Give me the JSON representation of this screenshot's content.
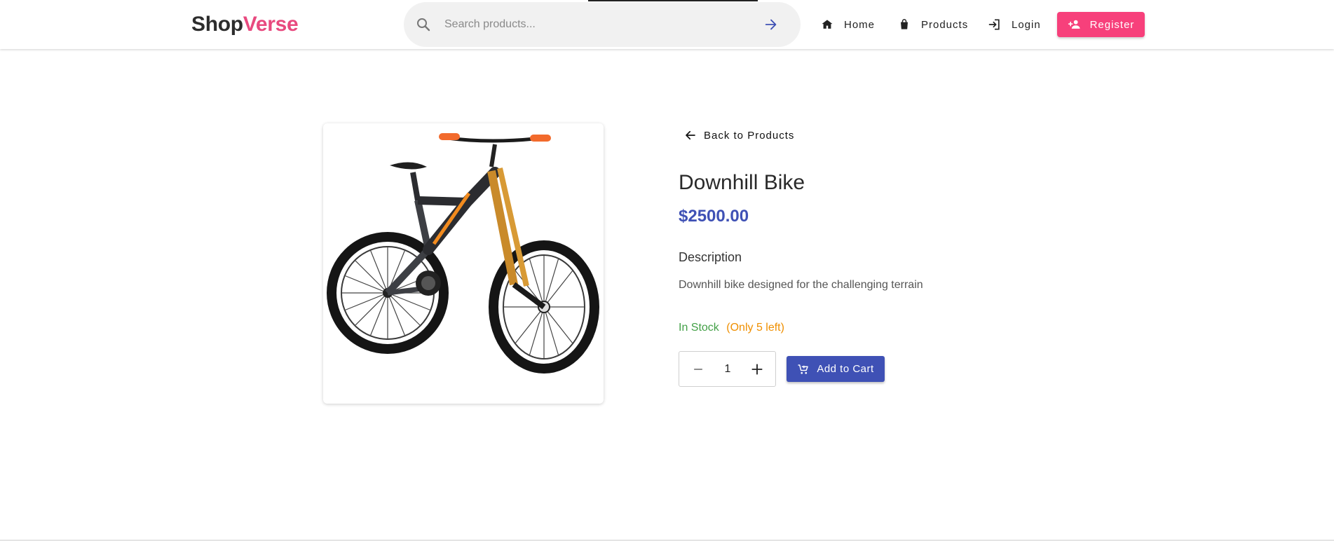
{
  "header": {
    "logo_part1": "Shop",
    "logo_part2": "Verse",
    "search": {
      "placeholder": "Search products...",
      "value": "",
      "icon": "search-icon",
      "submit_icon": "arrow-right-icon"
    },
    "nav": {
      "home": {
        "label": "Home",
        "icon": "home-icon"
      },
      "products": {
        "label": "Products",
        "icon": "shopping-bag-icon"
      },
      "login": {
        "label": "Login",
        "icon": "login-icon"
      },
      "register": {
        "label": "Register",
        "icon": "person-add-icon"
      }
    }
  },
  "product": {
    "back_label": "Back to Products",
    "title": "Downhill Bike",
    "price": "$2500.00",
    "description_heading": "Description",
    "description": "Downhill bike designed for the challenging terrain",
    "stock_status": "In Stock",
    "stock_left": "(Only 5 left)",
    "quantity": "1",
    "add_to_cart_label": "Add to Cart",
    "image_alt": "Downhill Bike"
  },
  "colors": {
    "brand_dark": "#2d2d2d",
    "brand_pink": "#e84a7f",
    "register_bg": "#f7407b",
    "primary": "#3f51b5",
    "in_stock": "#43a047",
    "stock_warning": "#ef8f00"
  }
}
